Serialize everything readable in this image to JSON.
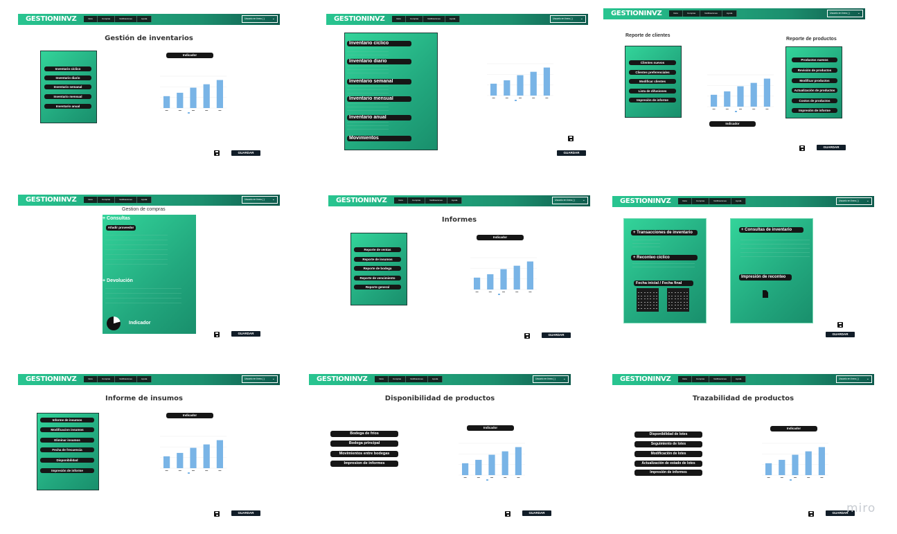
{
  "header": {
    "logo": "GESTIONINVZ",
    "nav": [
      "Inicio",
      "Compras",
      "Notificaciones",
      "Ayuda"
    ],
    "user": "Usuario en línea ( )",
    "brand_colors": {
      "light": "#28c590",
      "dark": "#0e5a4c"
    }
  },
  "common": {
    "save_label": "GUARDAR",
    "indicator_label": "Indicador"
  },
  "frames": {
    "f1": {
      "title": "Gestión de inventarios",
      "menu": [
        "Inventario cíclico",
        "Inventario diario",
        "Inventario semanal",
        "Inventario mensual",
        "Inventario anual"
      ]
    },
    "f2": {
      "menu": [
        "Inventario cíclico",
        "Inventario diario",
        "Inventario semanal",
        "Inventario mensual",
        "Inventario anual",
        "Movimientos"
      ]
    },
    "f3": {
      "clients_title": "Reporte de clientes",
      "clients": [
        "Clientes nuevos",
        "Clientes preferenciales",
        "Modificar clientes",
        "Lista de difusiones",
        "Impresión de informe"
      ],
      "products_title": "Reporte de productos",
      "products": [
        "Productos nuevos",
        "Revisión de productos",
        "Modificar productos",
        "Actualización de productos",
        "Costos de productos",
        "Impresión de informe"
      ]
    },
    "f4": {
      "title": "Gestion de compras",
      "consultas": "+ Consultas",
      "add_provider": "Añadir proveedor",
      "devolucion": "+ Devolución"
    },
    "f5": {
      "title": "Informes",
      "menu": [
        "Reporte de ventas",
        "Reporte de insumos",
        "Reporte de bodega",
        "Reporte de vencimiento",
        "Reporte general"
      ]
    },
    "f6": {
      "transactions": "+ Transacciones de inventario",
      "recount": "+ Reconteo cíclico",
      "dates": "Fecha inicial / Fecha final",
      "consults": "+ Consultas de inventario",
      "print": "Impresión de reconteo"
    },
    "f7": {
      "title": "Informe de insumos",
      "menu": [
        "Informe de insumos",
        "Modificacion insumos",
        "Eliminar insumos",
        "Fecha de frecuencia",
        "Disponibilidad",
        "Impresión de informe"
      ]
    },
    "f8": {
      "title": "Disponibilidad de productos",
      "menu": [
        "Bodega de fríos",
        "Bodega principal",
        "Movimientos entre bodegas",
        "Impresion de informes"
      ]
    },
    "f9": {
      "title": "Trazabilidad de productos",
      "menu": [
        "Disponibilidad de lotes",
        "Seguimiento de lotes",
        "Modificación de lotes",
        "Actualización de estado de lotes",
        "Impresión de informes"
      ]
    }
  },
  "chart_data": {
    "type": "bar",
    "categories": [
      "",
      "",
      "",
      "",
      ""
    ],
    "values": [
      28,
      36,
      48,
      56,
      66
    ],
    "ylim": [
      0,
      75
    ],
    "bar_color": "#79b4e6"
  },
  "watermark": "miro"
}
